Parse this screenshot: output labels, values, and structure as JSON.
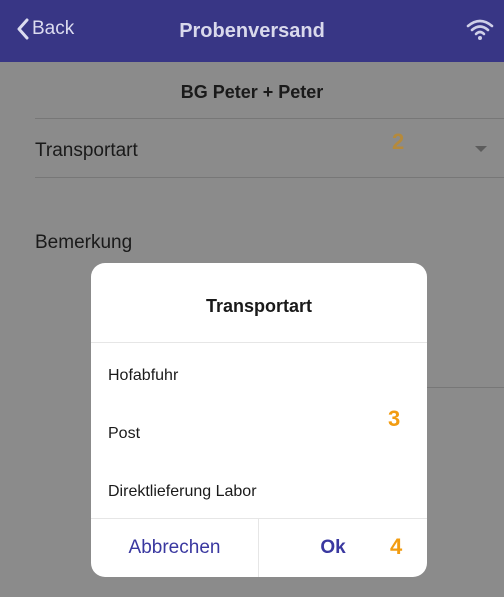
{
  "navbar": {
    "back_label": "Back",
    "title": "Probenversand",
    "back_icon": "chevron-left-icon",
    "status_icon": "wifi-icon"
  },
  "page": {
    "subtitle": "BG Peter + Peter",
    "transport_label": "Transportart",
    "remark_label": "Bemerkung"
  },
  "markers": {
    "m2": "2",
    "m3": "3",
    "m4": "4"
  },
  "dialog": {
    "title": "Transportart",
    "options": [
      "Hofabfuhr",
      "Post",
      "Direktlieferung Labor"
    ],
    "cancel_label": "Abbrechen",
    "ok_label": "Ok"
  },
  "colors": {
    "navbar": "#383685",
    "accent": "#3a38a0",
    "marker": "#f29c11",
    "overlay": "#8b8b8b"
  }
}
